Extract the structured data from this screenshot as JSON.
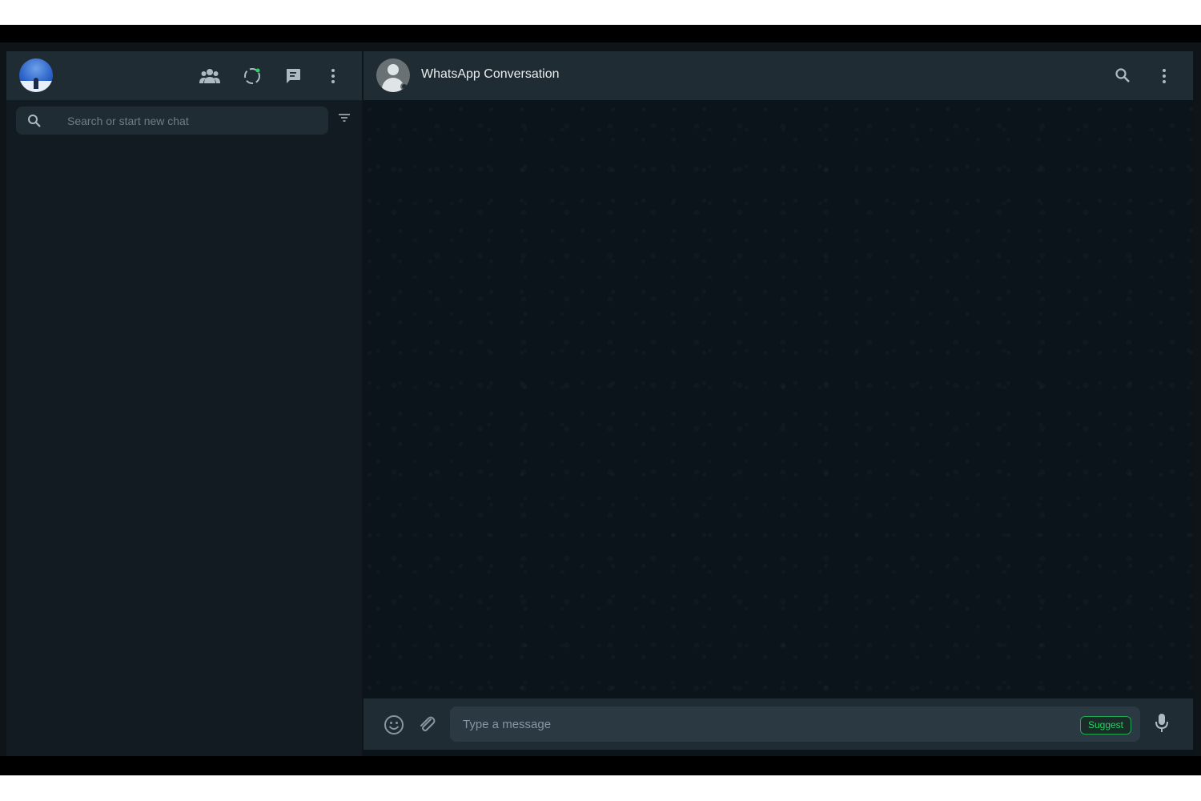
{
  "sidebar": {
    "header": {
      "icons": [
        "communities-icon",
        "status-icon",
        "new-chat-icon",
        "menu-icon"
      ]
    },
    "search": {
      "placeholder": "Search or start new chat"
    }
  },
  "chat": {
    "header": {
      "contact_name": "WhatsApp Conversation"
    },
    "composer": {
      "placeholder": "Type a message",
      "suggest_label": "Suggest"
    }
  },
  "colors": {
    "panel_bg": "#111b21",
    "header_bg": "#202c33",
    "chat_bg": "#0b141a",
    "accent": "#25d366",
    "icon": "#aebac1"
  }
}
